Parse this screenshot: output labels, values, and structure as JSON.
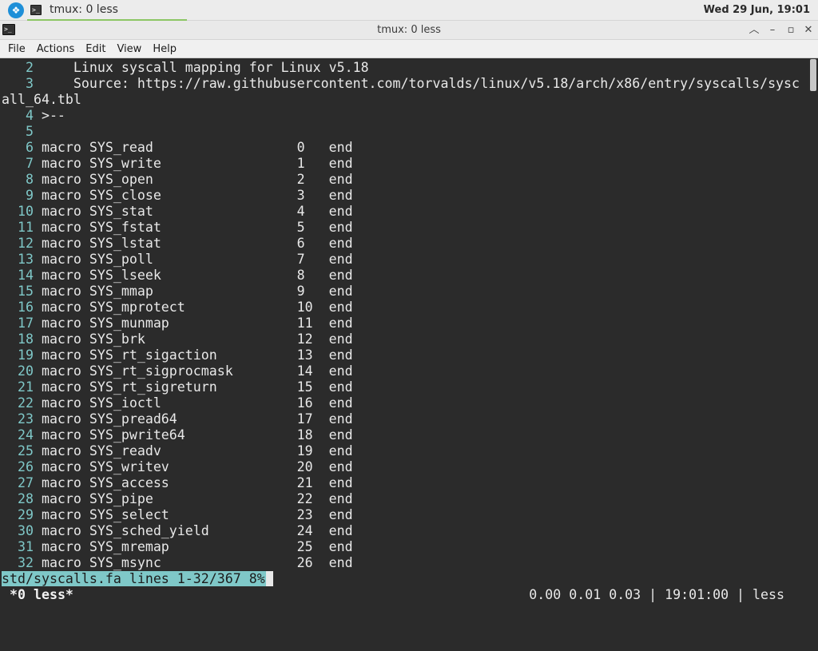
{
  "panel": {
    "task_label": "tmux: 0 less",
    "task_icon_text": ">_",
    "clock": "Wed 29 Jun, 19:01"
  },
  "window": {
    "title": "tmux: 0 less",
    "icon_text": ">_"
  },
  "menu": [
    "File",
    "Actions",
    "Edit",
    "View",
    "Help"
  ],
  "terminal": {
    "lines": [
      {
        "num": "   2 ",
        "text": "    Linux syscall mapping for Linux v5.18"
      },
      {
        "num": "   3 ",
        "text": "    Source: https://raw.githubusercontent.com/torvalds/linux/v5.18/arch/x86/entry/syscalls/sysc"
      },
      {
        "num": "",
        "text": "all_64.tbl"
      },
      {
        "num": "   4 ",
        "text": ">--"
      },
      {
        "num": "   5 ",
        "text": ""
      },
      {
        "num": "   6 ",
        "text": "macro SYS_read                  0   end"
      },
      {
        "num": "   7 ",
        "text": "macro SYS_write                 1   end"
      },
      {
        "num": "   8 ",
        "text": "macro SYS_open                  2   end"
      },
      {
        "num": "   9 ",
        "text": "macro SYS_close                 3   end"
      },
      {
        "num": "  10 ",
        "text": "macro SYS_stat                  4   end"
      },
      {
        "num": "  11 ",
        "text": "macro SYS_fstat                 5   end"
      },
      {
        "num": "  12 ",
        "text": "macro SYS_lstat                 6   end"
      },
      {
        "num": "  13 ",
        "text": "macro SYS_poll                  7   end"
      },
      {
        "num": "  14 ",
        "text": "macro SYS_lseek                 8   end"
      },
      {
        "num": "  15 ",
        "text": "macro SYS_mmap                  9   end"
      },
      {
        "num": "  16 ",
        "text": "macro SYS_mprotect              10  end"
      },
      {
        "num": "  17 ",
        "text": "macro SYS_munmap                11  end"
      },
      {
        "num": "  18 ",
        "text": "macro SYS_brk                   12  end"
      },
      {
        "num": "  19 ",
        "text": "macro SYS_rt_sigaction          13  end"
      },
      {
        "num": "  20 ",
        "text": "macro SYS_rt_sigprocmask        14  end"
      },
      {
        "num": "  21 ",
        "text": "macro SYS_rt_sigreturn          15  end"
      },
      {
        "num": "  22 ",
        "text": "macro SYS_ioctl                 16  end"
      },
      {
        "num": "  23 ",
        "text": "macro SYS_pread64               17  end"
      },
      {
        "num": "  24 ",
        "text": "macro SYS_pwrite64              18  end"
      },
      {
        "num": "  25 ",
        "text": "macro SYS_readv                 19  end"
      },
      {
        "num": "  26 ",
        "text": "macro SYS_writev                20  end"
      },
      {
        "num": "  27 ",
        "text": "macro SYS_access                21  end"
      },
      {
        "num": "  28 ",
        "text": "macro SYS_pipe                  22  end"
      },
      {
        "num": "  29 ",
        "text": "macro SYS_select                23  end"
      },
      {
        "num": "  30 ",
        "text": "macro SYS_sched_yield           24  end"
      },
      {
        "num": "  31 ",
        "text": "macro SYS_mremap                25  end"
      },
      {
        "num": "  32 ",
        "text": "macro SYS_msync                 26  end"
      }
    ],
    "less_status": "std/syscalls.fa lines 1-32/367 8%",
    "tmux_window": "*0 less*",
    "tmux_status_right": "0.00 0.01 0.03 | 19:01:00 | less"
  }
}
